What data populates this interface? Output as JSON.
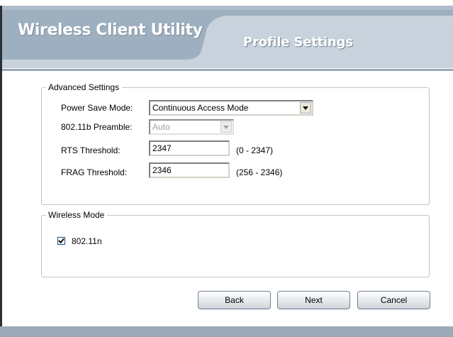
{
  "header": {
    "app_title": "Wireless Client Utility",
    "page_title": "Profile Settings"
  },
  "advanced_settings": {
    "legend": "Advanced Settings",
    "power_save_mode": {
      "label": "Power Save Mode:",
      "value": "Continuous Access Mode"
    },
    "preamble": {
      "label": "802.11b Preamble:",
      "value": "Auto",
      "disabled": true
    },
    "rts_threshold": {
      "label": "RTS Threshold:",
      "value": "2347",
      "range": "(0 - 2347)"
    },
    "frag_threshold": {
      "label": "FRAG Threshold:",
      "value": "2346",
      "range": "(256 - 2346)"
    }
  },
  "wireless_mode": {
    "legend": "Wireless Mode",
    "option_label": "802.11n",
    "checked": true
  },
  "buttons": {
    "back": "Back",
    "next": "Next",
    "cancel": "Cancel"
  },
  "colors": {
    "header_band": "#9eb0c0",
    "header_tab": "#b9c6d2",
    "footer": "#9ca9b6"
  },
  "icons": [
    "chevron-down-icon",
    "checkmark-icon"
  ]
}
